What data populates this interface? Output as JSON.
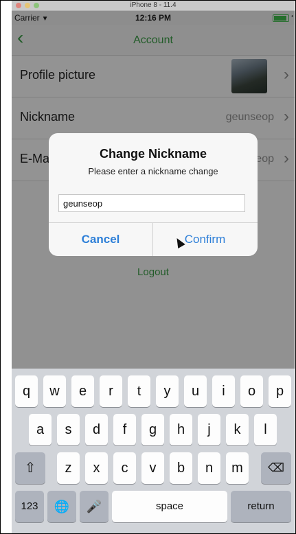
{
  "simulator": {
    "title": "iPhone 8 - 11.4"
  },
  "status_bar": {
    "carrier": "Carrier",
    "wifi_icon": "wifi-icon",
    "time": "12:16 PM",
    "battery_color": "#3fb84a"
  },
  "nav": {
    "back_icon": "chevron-left-icon",
    "title": "Account"
  },
  "rows": {
    "profile": {
      "label": "Profile picture"
    },
    "nickname": {
      "label": "Nickname",
      "value": "geunseop"
    },
    "email": {
      "label": "E-Mail",
      "value": "geunseop"
    }
  },
  "logout": "Logout",
  "alert": {
    "title": "Change Nickname",
    "message": "Please enter a nickname change",
    "input_value": "geunseop",
    "cancel": "Cancel",
    "confirm": "Confirm"
  },
  "keyboard": {
    "row1": [
      "q",
      "w",
      "e",
      "r",
      "t",
      "y",
      "u",
      "i",
      "o",
      "p"
    ],
    "row2": [
      "a",
      "s",
      "d",
      "f",
      "g",
      "h",
      "j",
      "k",
      "l"
    ],
    "row3": [
      "z",
      "x",
      "c",
      "v",
      "b",
      "n",
      "m"
    ],
    "numbers": "123",
    "space": "space",
    "return": "return"
  },
  "colors": {
    "accent_green": "#3a9a45",
    "alert_button_blue": "#2d7fd8"
  }
}
